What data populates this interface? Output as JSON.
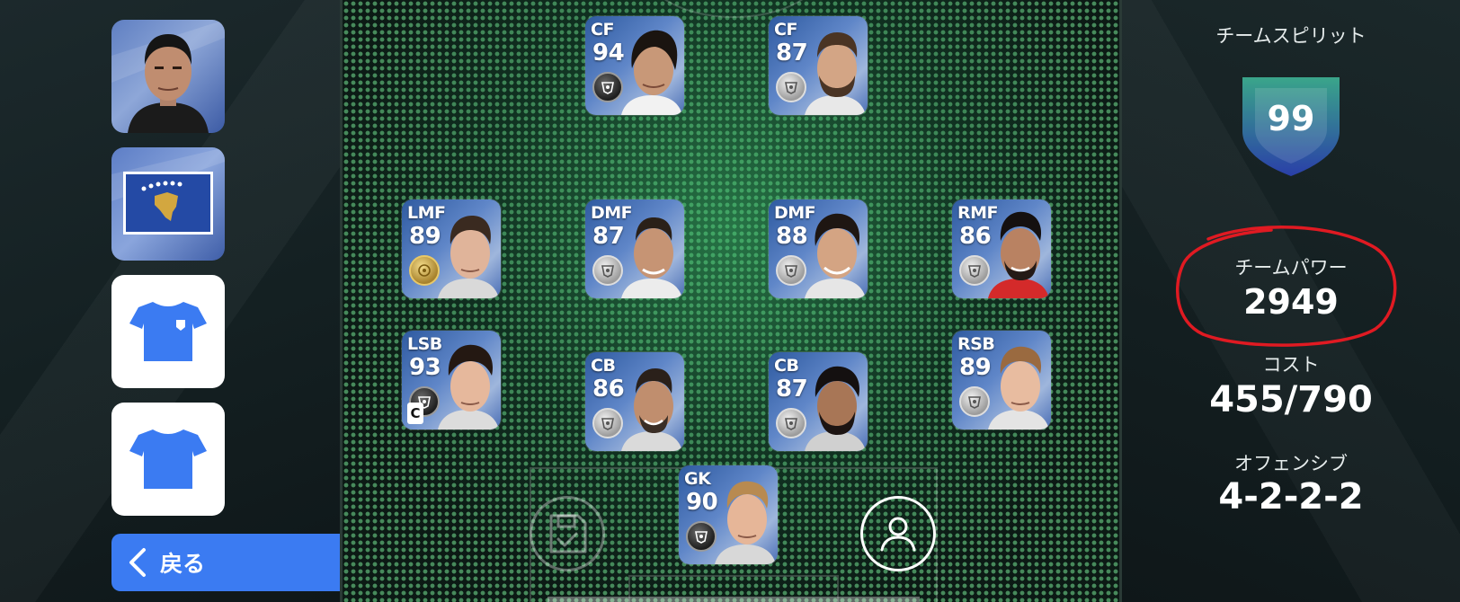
{
  "left_menu": {
    "manager_tile": "manager-photo",
    "flag_tile": "kosovo-flag",
    "kit_tiles": [
      "home-kit",
      "away-kit"
    ],
    "back_label": "戻る"
  },
  "team_stats": {
    "spirit_label": "チームスピリット",
    "spirit_value": "99",
    "power_label": "チームパワー",
    "power_value": "2949",
    "cost_label": "コスト",
    "cost_value": "455/790",
    "style_label": "オフェンシブ",
    "formation_value": "4-2-2-2"
  },
  "players": [
    {
      "pos": "CF",
      "ovr": "94",
      "medal": "black",
      "captain": ""
    },
    {
      "pos": "CF",
      "ovr": "87",
      "medal": "silver",
      "captain": ""
    },
    {
      "pos": "LMF",
      "ovr": "89",
      "medal": "gold",
      "captain": ""
    },
    {
      "pos": "DMF",
      "ovr": "87",
      "medal": "silver",
      "captain": ""
    },
    {
      "pos": "DMF",
      "ovr": "88",
      "medal": "silver",
      "captain": ""
    },
    {
      "pos": "RMF",
      "ovr": "86",
      "medal": "silver",
      "captain": ""
    },
    {
      "pos": "LSB",
      "ovr": "93",
      "medal": "black",
      "captain": "C"
    },
    {
      "pos": "CB",
      "ovr": "86",
      "medal": "silver",
      "captain": ""
    },
    {
      "pos": "CB",
      "ovr": "87",
      "medal": "silver",
      "captain": ""
    },
    {
      "pos": "RSB",
      "ovr": "89",
      "medal": "silver",
      "captain": ""
    },
    {
      "pos": "GK",
      "ovr": "90",
      "medal": "black",
      "captain": ""
    }
  ],
  "icons": {
    "save": "save-icon",
    "profile": "person-icon",
    "back": "chevron-left-icon"
  },
  "colors": {
    "accent_blue": "#3b7bf2",
    "kit_blue": "#3b7bf2",
    "spirit_badge_top": "#3aa58a",
    "spirit_badge_bottom": "#2a3fa8",
    "annotation_red": "#e01a22"
  }
}
